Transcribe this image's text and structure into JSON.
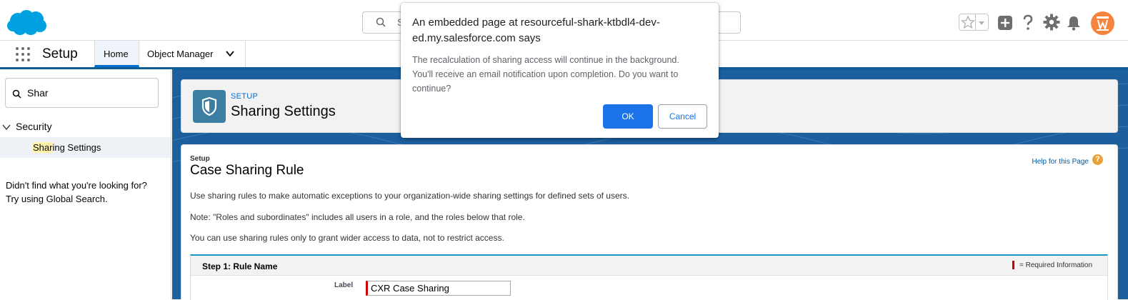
{
  "header": {
    "search_placeholder": "S",
    "icons": [
      "salesforce-logo",
      "search-icon",
      "favorites-star-icon",
      "chevron-down-icon",
      "add-icon",
      "help-icon",
      "gear-icon",
      "bell-icon",
      "avatar"
    ]
  },
  "nav": {
    "app_name": "Setup",
    "tabs": [
      {
        "label": "Home",
        "active": true
      },
      {
        "label": "Object Manager",
        "active": false
      }
    ]
  },
  "sidebar": {
    "quickfind_value": "Shar",
    "section_label": "Security",
    "item_highlight": "Shar",
    "item_rest": "ing Settings",
    "not_found_line1": "Didn't find what you're looking for?",
    "not_found_line2": "Try using Global Search."
  },
  "page_header": {
    "eyebrow": "SETUP",
    "title": "Sharing Settings"
  },
  "content": {
    "setup_label": "Setup",
    "title": "Case Sharing Rule",
    "help_link": "Help for this Page",
    "help_icon": "?",
    "paragraphs": [
      "Use sharing rules to make automatic exceptions to your organization-wide sharing settings for defined sets of users.",
      "Note: \"Roles and subordinates\" includes all users in a role, and the roles below that role.",
      "You can use sharing rules only to grant wider access to data, not to restrict access."
    ],
    "step_title": "Step 1: Rule Name",
    "required_info": "= Required Information",
    "label_field_label": "Label",
    "label_field_value": "CXR Case Sharing"
  },
  "dialog": {
    "title": "An embedded page at resourceful-shark-ktbdl4-dev-ed.my.salesforce.com says",
    "message": "The recalculation of sharing access will continue in the background. You'll receive an email notification upon completion. Do you want to continue?",
    "ok_label": "OK",
    "cancel_label": "Cancel"
  },
  "colors": {
    "brand_blue": "#00a1e0",
    "dialog_ok": "#1a73e8",
    "setup_icon": "#3b7ea1",
    "avatar": "#f4843e"
  }
}
